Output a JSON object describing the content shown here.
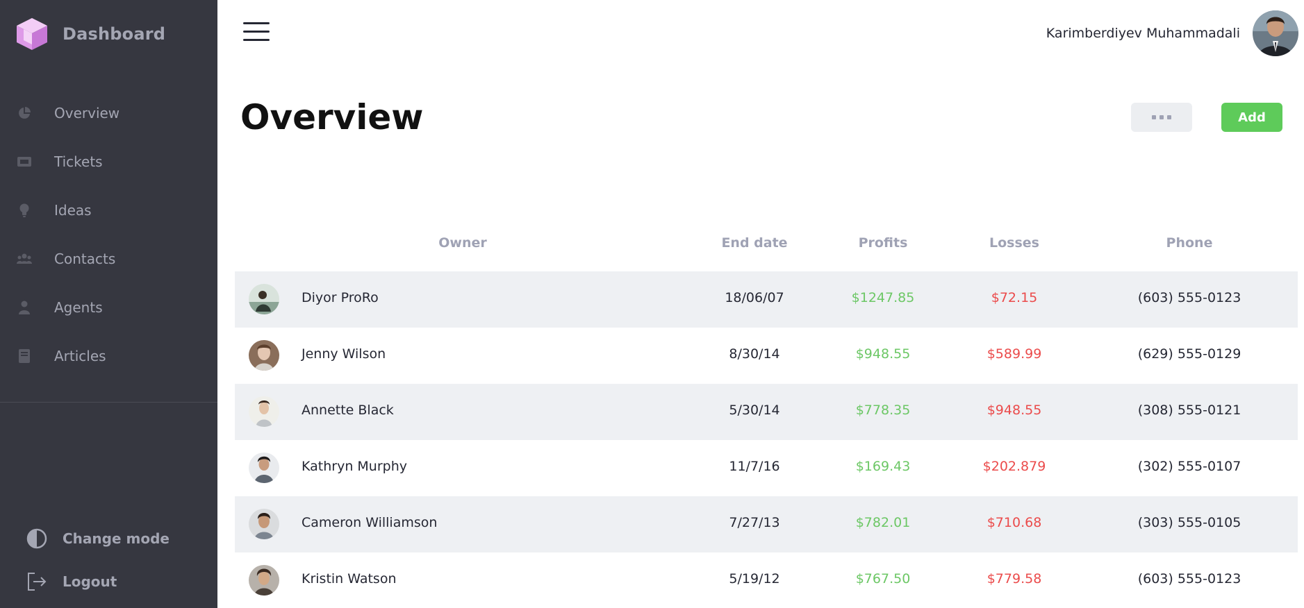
{
  "sidebar": {
    "brand": "Dashboard",
    "items": [
      {
        "label": "Overview",
        "icon": "pie-chart-icon"
      },
      {
        "label": "Tickets",
        "icon": "ticket-icon"
      },
      {
        "label": "Ideas",
        "icon": "lightbulb-icon"
      },
      {
        "label": "Contacts",
        "icon": "users-icon"
      },
      {
        "label": "Agents",
        "icon": "agent-icon"
      },
      {
        "label": "Articles",
        "icon": "book-icon"
      }
    ],
    "change_mode": "Change mode",
    "logout": "Logout"
  },
  "header": {
    "user_name": "Karimberdiyev Muhammadali"
  },
  "main": {
    "title": "Overview",
    "add_label": "Add"
  },
  "table": {
    "columns": [
      "Owner",
      "End date",
      "Profits",
      "Losses",
      "Phone"
    ],
    "rows": [
      {
        "name": "Diyor ProRo",
        "date": "18/06/07",
        "profit": "$1247.85",
        "loss": "$72.15",
        "phone": "(603) 555-0123"
      },
      {
        "name": "Jenny Wilson",
        "date": "8/30/14",
        "profit": "$948.55",
        "loss": "$589.99",
        "phone": "(629) 555-0129"
      },
      {
        "name": "Annette Black",
        "date": "5/30/14",
        "profit": "$778.35",
        "loss": "$948.55",
        "phone": "(308) 555-0121"
      },
      {
        "name": "Kathryn Murphy",
        "date": "11/7/16",
        "profit": "$169.43",
        "loss": "$202.879",
        "phone": "(302) 555-0107"
      },
      {
        "name": "Cameron Williamson",
        "date": "7/27/13",
        "profit": "$782.01",
        "loss": "$710.68",
        "phone": "(303) 555-0105"
      },
      {
        "name": "Kristin Watson",
        "date": "5/19/12",
        "profit": "$767.50",
        "loss": "$779.58",
        "phone": "(603) 555-0123"
      }
    ]
  },
  "colors": {
    "sidebar_bg": "#363740",
    "sidebar_text": "#A4A6B3",
    "accent_green": "#5ECB5A",
    "profit": "#6CC765",
    "loss": "#EB4B4B",
    "row_alt": "#EEF0F3"
  }
}
